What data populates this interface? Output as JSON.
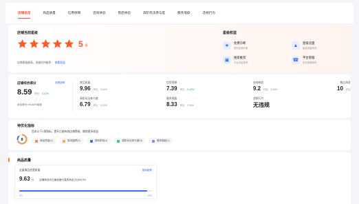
{
  "tabs": [
    {
      "label": "店铺总览",
      "active": true
    },
    {
      "label": "商品质量",
      "active": false
    },
    {
      "label": "信用保障",
      "active": false
    },
    {
      "label": "咨询体验",
      "active": false
    },
    {
      "label": "售后体验",
      "active": false
    },
    {
      "label": "高阶玩法参与度",
      "active": false
    },
    {
      "label": "服务瑕疵",
      "active": false
    },
    {
      "label": "违规行为",
      "active": false
    }
  ],
  "level": {
    "title": "店铺当前星级",
    "stars": 5,
    "value": "5",
    "unit": "星",
    "note": "店铺星级越高，流量扶持越多~",
    "note_link": "查看权益",
    "rights_title": "星级权益",
    "rights": [
      {
        "icon": "gift-icon",
        "title": "免费诊断",
        "sub": "提供店铺诊断"
      },
      {
        "icon": "star-icon",
        "title": "星级流量",
        "sub": "星级流量扶持"
      },
      {
        "icon": "monitor-icon",
        "title": "搜索推荐",
        "sub": "平台流量推荐"
      },
      {
        "icon": "support-icon",
        "title": "平台客服",
        "sub": "优先客服服务"
      }
    ]
  },
  "scores": {
    "title": "店铺综合得分",
    "link": "查看趋势",
    "value": "8.59",
    "compare_label": "环比",
    "change": "0.07%",
    "rank": "综合得分>99.80%商家",
    "metrics": [
      {
        "label": "商品质量",
        "value": "9.96",
        "cmp": "环比",
        "change": "0.00%"
      },
      {
        "label": "信用保障",
        "value": "7.39",
        "cmp": "环比",
        "change": "0.12%"
      },
      {
        "label": "咨询体验",
        "value": "9.2",
        "cmp": "环比",
        "change": "0.00%"
      },
      {
        "label": "售后体验",
        "value": "10",
        "cmp": "环比",
        "change": ""
      },
      {
        "label": "高阶玩法参与度",
        "value": "6.79",
        "cmp": "环比",
        "change": "0.00%"
      },
      {
        "label": "服务瑕疵",
        "value": "8.33",
        "cmp": "环比",
        "change": "0.00%"
      },
      {
        "label": "违规行为",
        "value": "无违规",
        "cmp": "",
        "change": ""
      }
    ]
  },
  "todo": {
    "title": "待优化指标",
    "count": "8",
    "count_unit": "项",
    "text_prefix": "您本以下",
    "text_highlight": "8",
    "text_suffix": "项指标，提升后能有效店铺等级、解锁更多权益",
    "chips": [
      {
        "label": "商品质量(1)",
        "color": "#ff8a4c"
      },
      {
        "label": "信用保障(2)",
        "color": "#f7b23b"
      },
      {
        "label": "咨询体验(1)",
        "color": "#3b6cf6"
      },
      {
        "label": "高阶玩法参与度(3)",
        "color": "#36c98f"
      },
      {
        "label": "服务瑕疵(1)",
        "color": "#a37cf0"
      }
    ]
  },
  "quality": {
    "title": "商品质量",
    "section_label": "全量商品经营质量",
    "section_link": "指标趋势",
    "value": "9.63",
    "unit": "分",
    "desc": "店铺商品中正面经营分高的商品占比59.3%",
    "progress": 0.96,
    "axis_left": "0分",
    "axis_right": "10分"
  },
  "colors": {
    "accent": "#ff4d2d",
    "star": "#ff5a1f",
    "link": "#2f6bff"
  }
}
